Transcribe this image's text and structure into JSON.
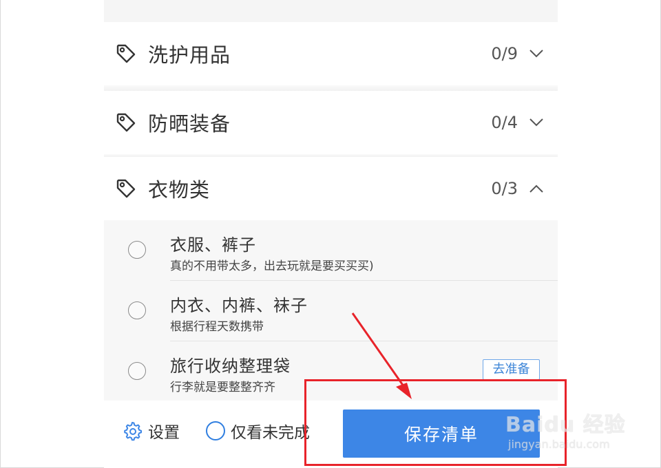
{
  "categories": [
    {
      "name": "洗护用品",
      "count": "0/9",
      "expanded": false
    },
    {
      "name": "防晒装备",
      "count": "0/4",
      "expanded": false
    },
    {
      "name": "衣物类",
      "count": "0/3",
      "expanded": true
    }
  ],
  "items": [
    {
      "title": "衣服、裤子",
      "desc": "真的不用带太多，出去玩就是要买买买)",
      "action": ""
    },
    {
      "title": "内衣、内裤、袜子",
      "desc": "根据行程天数携带",
      "action": ""
    },
    {
      "title": "旅行收纳整理袋",
      "desc": "行李就是要整整齐齐",
      "action": "去准备"
    }
  ],
  "footer": {
    "settings_label": "设置",
    "only_unfinished_label": "仅看未完成",
    "save_label": "保存清单"
  },
  "watermark": {
    "brand": "Baidu 经验",
    "sub": "jingyan.baidu.com"
  },
  "colors": {
    "accent": "#3d86e6",
    "annotation": "#e8232a"
  },
  "icons": {
    "category": "tag-icon",
    "collapsed": "chevron-down-icon",
    "expanded": "chevron-up-icon",
    "settings": "gear-icon"
  }
}
